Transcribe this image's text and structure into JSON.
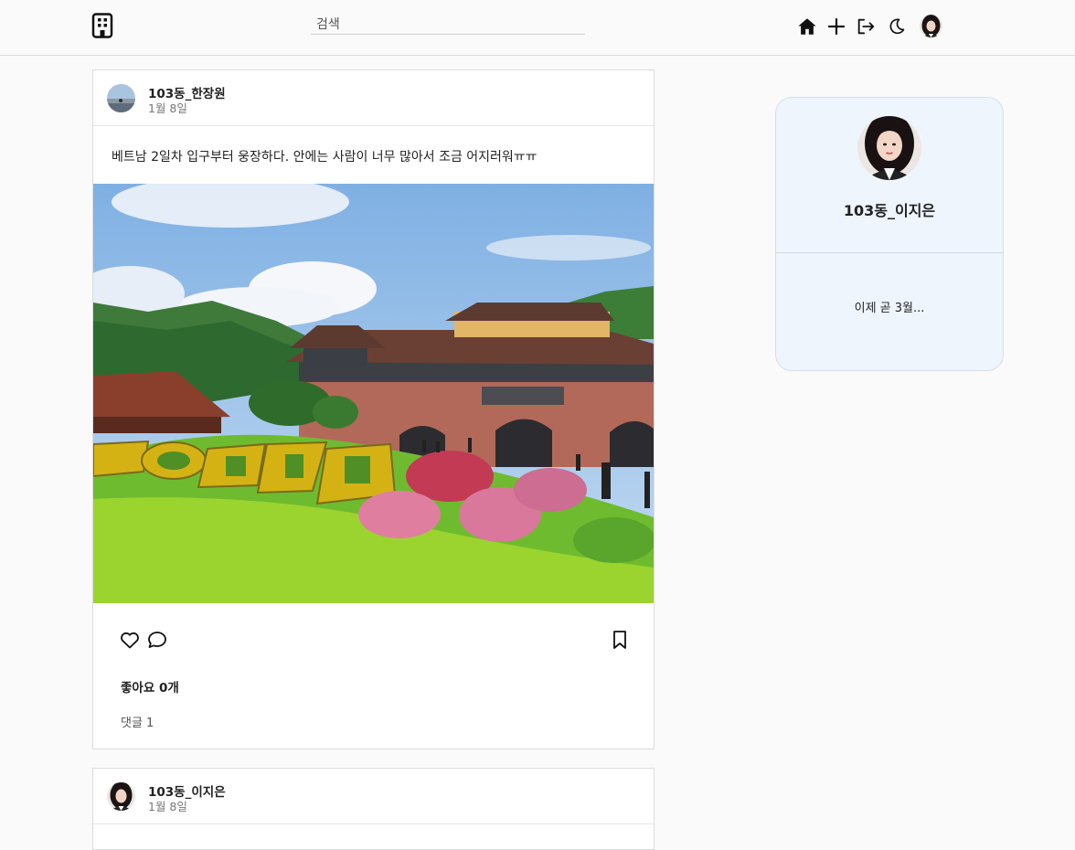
{
  "header": {
    "logo_icon": "building-icon",
    "search_placeholder": "검색",
    "nav_icons": [
      "home-icon",
      "plus-icon",
      "logout-icon",
      "moon-icon"
    ]
  },
  "posts": [
    {
      "author": "103동_한장원",
      "date": "1월 8일",
      "text": "베트남 2일차 입구부터 웅장하다. 안에는 사람이 너무 많아서 조금 어지러워ㅠㅠ",
      "likes": "좋아요 0개",
      "comments": "댓글 1"
    },
    {
      "author": "103동_이지은",
      "date": "1월 8일"
    }
  ],
  "profile": {
    "name": "103동_이지은",
    "status": "이제 곧 3월..."
  },
  "colors": {
    "card_bg": "#eef5fd",
    "border": "#dbdbdb",
    "background": "#fafafa"
  }
}
